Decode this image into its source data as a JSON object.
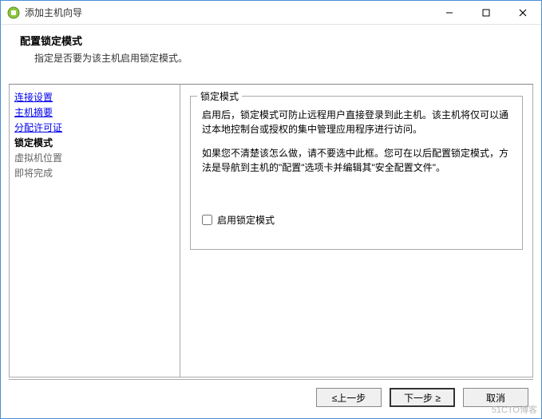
{
  "window": {
    "title": "添加主机向导"
  },
  "header": {
    "title": "配置锁定模式",
    "subtitle": "指定是否要为该主机启用锁定模式。"
  },
  "sidebar": {
    "items": [
      {
        "label": "连接设置",
        "state": "link"
      },
      {
        "label": "主机摘要",
        "state": "link"
      },
      {
        "label": "分配许可证",
        "state": "link"
      },
      {
        "label": "锁定模式",
        "state": "current"
      },
      {
        "label": "虚拟机位置",
        "state": "future"
      },
      {
        "label": "即将完成",
        "state": "future"
      }
    ]
  },
  "panel": {
    "legend": "锁定模式",
    "para1": "启用后，锁定模式可防止远程用户直接登录到此主机。该主机将仅可以通过本地控制台或授权的集中管理应用程序进行访问。",
    "para2": "如果您不清楚该怎么做，请不要选中此框。您可在以后配置锁定模式，方法是导航到主机的\"配置\"选项卡并编辑其\"安全配置文件\"。",
    "checkbox_label": "启用锁定模式",
    "checkbox_checked": false
  },
  "buttons": {
    "back": "≤上一步",
    "next": "下一步 ≥",
    "cancel": "取消"
  },
  "watermark": "51CTO博客"
}
